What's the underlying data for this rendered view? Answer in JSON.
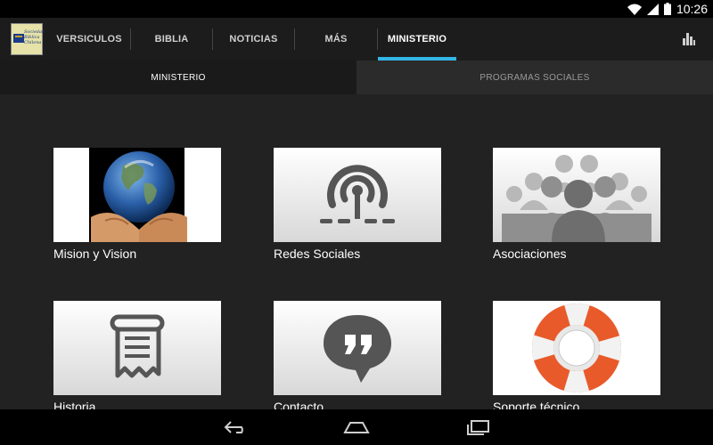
{
  "status_bar": {
    "time": "10:26",
    "icons": [
      "wifi-icon",
      "cell-signal-icon",
      "battery-icon"
    ]
  },
  "app": {
    "logo_lines": [
      "Sociedad",
      "Bíblica",
      "Chilena"
    ]
  },
  "tabs": [
    {
      "label": "VERSICULOS",
      "active": false
    },
    {
      "label": "BIBLIA",
      "active": false
    },
    {
      "label": "NOTICIAS",
      "active": false
    },
    {
      "label": "MÁS",
      "active": false
    },
    {
      "label": "MINISTERIO",
      "active": true
    }
  ],
  "sub_tabs": [
    {
      "label": "MINISTERIO",
      "active": true
    },
    {
      "label": "PROGRAMAS SOCIALES",
      "active": false
    }
  ],
  "tiles": [
    {
      "label": "Mision y Vision",
      "icon": "earth-in-hands-icon"
    },
    {
      "label": "Redes Sociales",
      "icon": "broadcast-icon"
    },
    {
      "label": "Asociaciones",
      "icon": "people-group-icon"
    },
    {
      "label": "Historia",
      "icon": "scroll-icon"
    },
    {
      "label": "Contacto",
      "icon": "quote-bubble-icon"
    },
    {
      "label": "Soporte técnico",
      "icon": "lifebuoy-icon"
    }
  ],
  "colors": {
    "accent": "#33b5e5",
    "background": "#222222",
    "action_bar": "#1c1c1c"
  }
}
